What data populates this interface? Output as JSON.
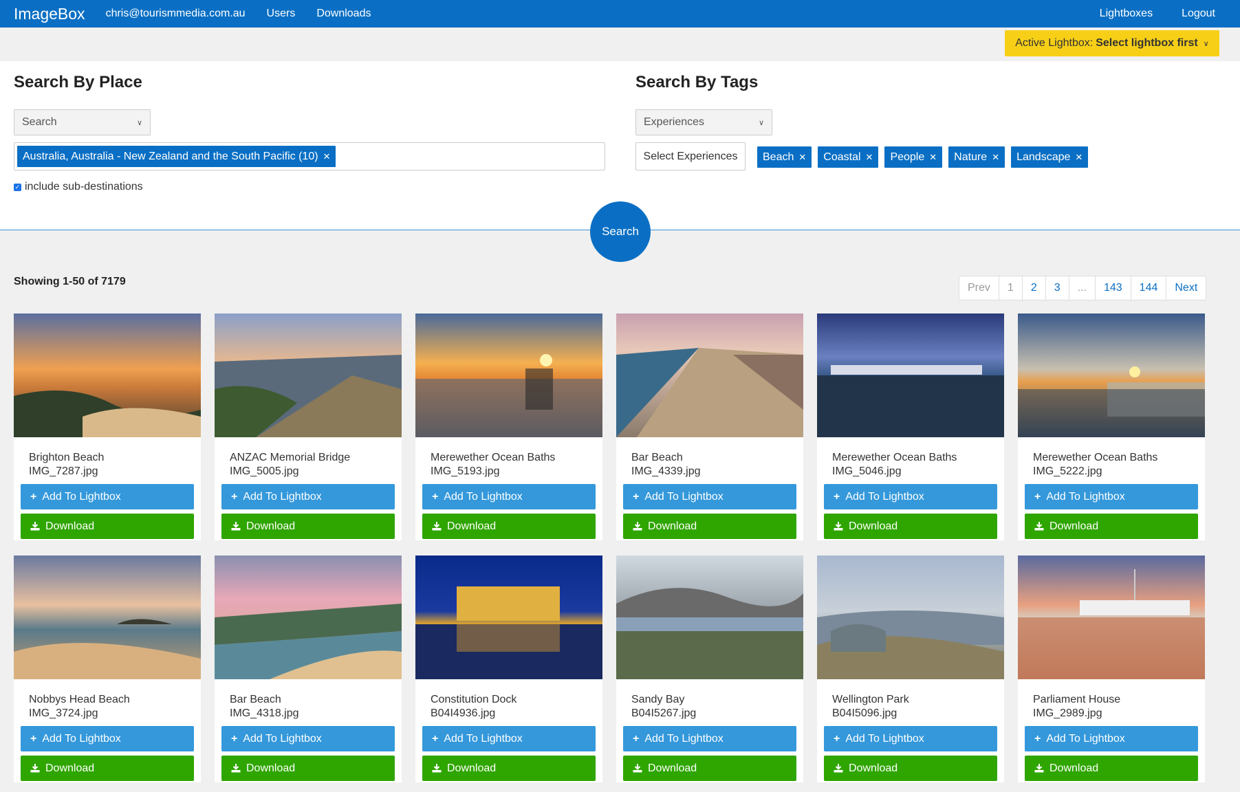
{
  "nav": {
    "brand": "ImageBox",
    "user_email": "chris@tourismmedia.com.au",
    "users": "Users",
    "downloads": "Downloads",
    "lightboxes": "Lightboxes",
    "logout": "Logout"
  },
  "active_lightbox": {
    "label": "Active Lightbox:",
    "value": "Select lightbox first"
  },
  "place": {
    "title": "Search By Place",
    "select_value": "Search",
    "selected_tag": "Australia, Australia - New Zealand and the South Pacific (10)",
    "include_sub": "include sub-destinations"
  },
  "tags": {
    "title": "Search By Tags",
    "select_value": "Experiences",
    "select_button": "Select Experiences",
    "items": [
      "Beach",
      "Coastal",
      "People",
      "Nature",
      "Landscape"
    ]
  },
  "search_button": "Search",
  "results": {
    "showing": "Showing 1-50 of 7179"
  },
  "pagination": [
    "Prev",
    "1",
    "2",
    "3",
    "...",
    "143",
    "144",
    "Next"
  ],
  "buttons": {
    "add": "Add To Lightbox",
    "download": "Download"
  },
  "images": [
    {
      "title": "Brighton Beach",
      "file": "IMG_7287.jpg"
    },
    {
      "title": "ANZAC Memorial Bridge",
      "file": "IMG_5005.jpg"
    },
    {
      "title": "Merewether Ocean Baths",
      "file": "IMG_5193.jpg"
    },
    {
      "title": "Bar Beach",
      "file": "IMG_4339.jpg"
    },
    {
      "title": "Merewether Ocean Baths",
      "file": "IMG_5046.jpg"
    },
    {
      "title": "Merewether Ocean Baths",
      "file": "IMG_5222.jpg"
    },
    {
      "title": "Nobbys Head Beach",
      "file": "IMG_3724.jpg"
    },
    {
      "title": "Bar Beach",
      "file": "IMG_4318.jpg"
    },
    {
      "title": "Constitution Dock",
      "file": "B04I4936.jpg"
    },
    {
      "title": "Sandy Bay",
      "file": "B04I5267.jpg"
    },
    {
      "title": "Wellington Park",
      "file": "B04I5096.jpg"
    },
    {
      "title": "Parliament House",
      "file": "IMG_2989.jpg"
    }
  ]
}
